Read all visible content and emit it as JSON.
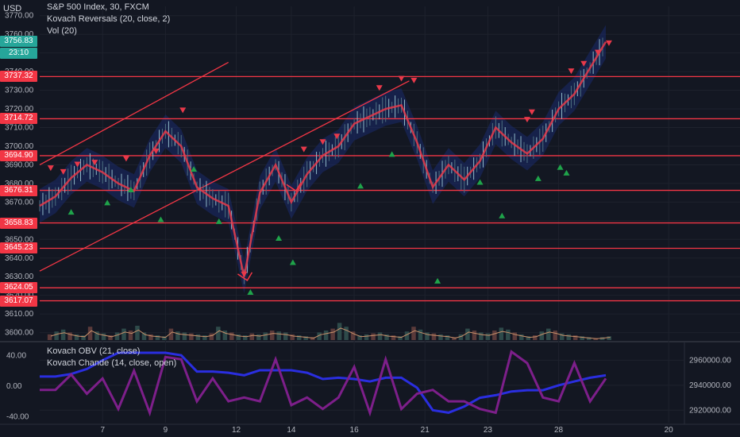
{
  "currency": "USD",
  "legend": {
    "title": "S&P 500 Index, 30, FXCM",
    "ind1": "Kovach Reversals (20, close, 2)",
    "ind2": "Vol (20)",
    "ind3": "Kovach OBV (21, close)",
    "ind4": "Kovach Chande (14, close, open)"
  },
  "badges": {
    "last_price": "3756.83",
    "countdown": "23:10",
    "level_colors": {
      "last": "#26a69a",
      "line": "#f23645"
    }
  },
  "chart_data": [
    {
      "type": "line",
      "name": "main-price",
      "y_ticks": [
        "3770.00",
        "3760.00",
        "3750.00",
        "3740.00",
        "3730.00",
        "3720.00",
        "3710.00",
        "3700.00",
        "3690.00",
        "3680.00",
        "3670.00",
        "3660.00",
        "3650.00",
        "3640.00",
        "3630.00",
        "3620.00",
        "3610.00",
        "3600.00"
      ],
      "y_tick_values": [
        3770,
        3760,
        3750,
        3740,
        3730,
        3720,
        3710,
        3700,
        3690,
        3680,
        3670,
        3660,
        3650,
        3640,
        3630,
        3620,
        3610,
        3600
      ],
      "ylim": [
        3596,
        3775
      ],
      "x_ticks": [
        "7",
        "9",
        "12",
        "14",
        "16",
        "21",
        "23",
        "28",
        "20"
      ],
      "x_tick_pos": [
        4,
        8,
        12.5,
        16,
        20,
        24.5,
        28.5,
        33,
        40
      ],
      "xlim": [
        0,
        41
      ],
      "horizontal_levels": [
        3737.32,
        3714.72,
        3694.9,
        3676.31,
        3658.83,
        3645.23,
        3624.05,
        3617.07
      ],
      "level_labels": [
        "3737.32",
        "3714.72",
        "3694.90",
        "3676.31",
        "3658.83",
        "3645.23",
        "3624.05",
        "3617.07"
      ],
      "trendlines": [
        {
          "x": [
            0,
            12
          ],
          "y": [
            3690,
            3745
          ]
        },
        {
          "x": [
            0,
            23.5
          ],
          "y": [
            3633,
            3735
          ]
        }
      ],
      "close_series": {
        "x": [
          0,
          1,
          2,
          3,
          4,
          5,
          6,
          7,
          8,
          9,
          10,
          11,
          12,
          13,
          14,
          15,
          16,
          17,
          18,
          19,
          20,
          21,
          22,
          23,
          24,
          25,
          26,
          27,
          28,
          29,
          30,
          31,
          32,
          33,
          34,
          35,
          36
        ],
        "y": [
          3668,
          3673,
          3683,
          3690,
          3686,
          3680,
          3676,
          3695,
          3708,
          3700,
          3678,
          3672,
          3668,
          3630,
          3675,
          3690,
          3670,
          3685,
          3695,
          3700,
          3712,
          3716,
          3720,
          3722,
          3702,
          3678,
          3690,
          3682,
          3692,
          3710,
          3702,
          3696,
          3704,
          3720,
          3728,
          3742,
          3756
        ]
      },
      "reversal_arrows": [
        {
          "x": 13.2,
          "y": 3628,
          "type": "line"
        },
        {
          "x": 16.3,
          "y": 3676,
          "type": "line"
        }
      ],
      "down_signals": [
        [
          0.7,
          3688
        ],
        [
          1.5,
          3686
        ],
        [
          2.4,
          3690
        ],
        [
          3.5,
          3691
        ],
        [
          5.5,
          3693
        ],
        [
          7.4,
          3697
        ],
        [
          9.1,
          3719
        ],
        [
          13.0,
          3631
        ],
        [
          16.8,
          3698
        ],
        [
          18.0,
          3702
        ],
        [
          18.9,
          3705
        ],
        [
          21.6,
          3731
        ],
        [
          23.0,
          3736
        ],
        [
          23.8,
          3735
        ],
        [
          31.0,
          3714
        ],
        [
          31.3,
          3718
        ],
        [
          33.8,
          3740
        ],
        [
          34.6,
          3744
        ],
        [
          35.5,
          3750
        ],
        [
          36.2,
          3755
        ]
      ],
      "up_signals": [
        [
          2.0,
          3665
        ],
        [
          4.3,
          3670
        ],
        [
          5.8,
          3677
        ],
        [
          7.7,
          3661
        ],
        [
          9.8,
          3688
        ],
        [
          11.4,
          3660
        ],
        [
          13.4,
          3622
        ],
        [
          15.2,
          3651
        ],
        [
          16.1,
          3638
        ],
        [
          20.4,
          3679
        ],
        [
          22.4,
          3696
        ],
        [
          25.3,
          3628
        ],
        [
          28.0,
          3681
        ],
        [
          29.4,
          3663
        ],
        [
          31.7,
          3683
        ],
        [
          33.1,
          3689
        ],
        [
          33.5,
          3686
        ]
      ],
      "volume": {
        "ylim": [
          0,
          40
        ],
        "values": [
          6,
          9,
          11,
          8,
          6,
          5,
          14,
          9,
          7,
          5,
          8,
          12,
          10,
          15,
          8,
          6,
          5,
          4,
          12,
          9,
          8,
          7,
          6,
          5,
          7,
          14,
          10,
          8,
          6,
          5,
          7,
          6,
          8,
          10,
          9,
          8,
          6,
          5,
          4,
          3,
          8,
          10,
          12,
          18,
          14,
          9,
          5,
          6,
          7,
          8,
          6,
          5,
          4,
          9,
          14,
          11,
          8,
          7,
          6,
          5,
          3,
          6,
          12,
          10,
          8,
          7,
          10,
          13,
          11,
          8,
          6,
          4,
          5,
          9,
          12,
          10,
          7,
          6,
          5,
          4,
          3,
          2,
          3,
          4
        ]
      }
    },
    {
      "type": "line",
      "name": "oscillator",
      "left_ticks": [
        "40.00",
        "0.00",
        "-40.00"
      ],
      "left_tick_values": [
        40,
        0,
        -40
      ],
      "left_ylim": [
        -48,
        55
      ],
      "right_ticks": [
        "2960000.00",
        "2940000.00",
        "2920000.00"
      ],
      "right_tick_values": [
        2960000,
        2940000,
        2920000
      ],
      "right_ylim": [
        2910000,
        2973000
      ],
      "series": [
        {
          "name": "Kovach OBV (21, close)",
          "x": [
            0,
            1,
            2,
            3,
            4,
            5,
            6,
            7,
            8,
            9,
            10,
            11,
            12,
            13,
            14,
            15,
            16,
            17,
            18,
            19,
            20,
            21,
            22,
            23,
            24,
            25,
            26,
            27,
            28,
            29,
            30,
            31,
            32,
            33,
            34,
            35,
            36
          ],
          "y": [
            2947000,
            2947000,
            2949000,
            2953000,
            2960000,
            2966000,
            2966000,
            2966000,
            2966000,
            2964000,
            2951000,
            2951000,
            2950000,
            2948000,
            2952000,
            2952000,
            2952000,
            2950000,
            2945000,
            2946000,
            2945000,
            2943000,
            2946000,
            2946000,
            2938000,
            2920000,
            2918000,
            2923000,
            2930000,
            2932000,
            2935000,
            2936000,
            2936000,
            2940000,
            2943000,
            2946000,
            2948000
          ]
        },
        {
          "name": "Kovach Chande (14, close, open)",
          "x": [
            0,
            1,
            2,
            3,
            4,
            5,
            6,
            7,
            8,
            9,
            10,
            11,
            12,
            13,
            14,
            15,
            16,
            17,
            18,
            19,
            20,
            21,
            22,
            23,
            24,
            25,
            26,
            27,
            28,
            29,
            30,
            31,
            32,
            33,
            34,
            35,
            36
          ],
          "y": [
            -5,
            -5,
            15,
            -10,
            10,
            -30,
            20,
            -35,
            38,
            35,
            -20,
            10,
            -20,
            -15,
            -20,
            35,
            -25,
            -15,
            -30,
            -15,
            25,
            -35,
            35,
            -30,
            -10,
            -5,
            -20,
            -20,
            -30,
            -35,
            45,
            30,
            -15,
            -20,
            30,
            -20,
            10
          ]
        }
      ]
    }
  ]
}
